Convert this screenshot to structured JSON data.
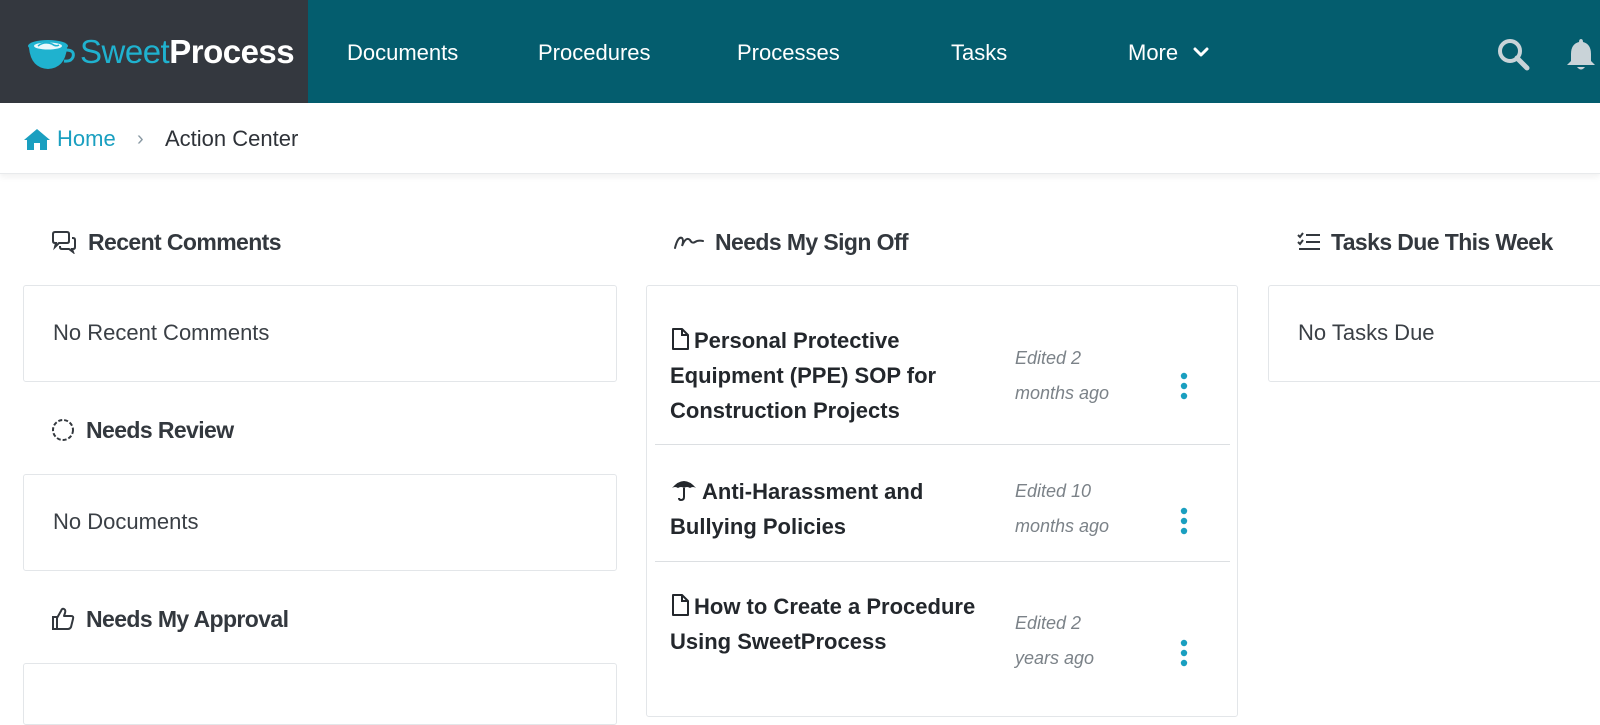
{
  "brand": {
    "name_part1": "Sweet",
    "name_part2": "Process"
  },
  "nav": {
    "items": [
      "Documents",
      "Procedures",
      "Processes",
      "Tasks"
    ],
    "more_label": "More"
  },
  "breadcrumb": {
    "home": "Home",
    "separator": "›",
    "current": "Action Center"
  },
  "sections": {
    "recent_comments": {
      "title": "Recent Comments",
      "empty": "No Recent Comments"
    },
    "needs_review": {
      "title": "Needs Review",
      "empty": "No Documents"
    },
    "needs_approval": {
      "title": "Needs My Approval"
    },
    "sign_off": {
      "title": "Needs My Sign Off",
      "items": [
        {
          "icon": "document-icon",
          "title": "Personal Protective Equipment (PPE) SOP for Construction Projects",
          "edited_line1": "Edited 2",
          "edited_line2": "months ago"
        },
        {
          "icon": "umbrella-icon",
          "title": "Anti-Harassment and Bullying Policies",
          "edited_line1": "Edited 10",
          "edited_line2": "months ago"
        },
        {
          "icon": "document-icon",
          "title": "How to Create a Procedure Using SweetProcess",
          "edited_line1": "Edited 2",
          "edited_line2": "years ago"
        }
      ]
    },
    "tasks_due": {
      "title": "Tasks Due This Week",
      "empty": "No Tasks Due"
    }
  },
  "colors": {
    "nav_bg": "#045d6e",
    "logo_bg": "#34383f",
    "accent": "#1a9fc0"
  }
}
